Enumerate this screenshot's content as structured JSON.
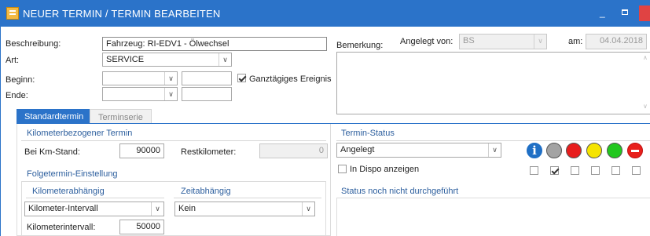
{
  "window": {
    "title": "NEUER TERMIN / TERMIN BEARBEITEN",
    "minimize": "_"
  },
  "form": {
    "beschreibung_label": "Beschreibung:",
    "beschreibung_value": "Fahrzeug: RI-EDV1 - Ölwechsel",
    "art_label": "Art:",
    "art_value": "SERVICE",
    "beginn_label": "Beginn:",
    "ende_label": "Ende:",
    "ganztaegig_label": "Ganztägiges Ereignis",
    "ganztaegig_checked": true,
    "bemerkung_label": "Bemerkung:",
    "angelegt_von_label": "Angelegt von:",
    "angelegt_von_value": "BS",
    "am_label": "am:",
    "am_value": "04.04.2018"
  },
  "tabs": [
    {
      "label": "Standardtermin",
      "active": true
    },
    {
      "label": "Terminserie",
      "active": false
    }
  ],
  "km_section": {
    "title": "Kilometerbezogener Termin",
    "km_stand_label": "Bei Km-Stand:",
    "km_stand_value": "90000",
    "rest_label": "Restkilometer:",
    "rest_value": "0"
  },
  "folge": {
    "title": "Folgetermin-Einstellung",
    "km_abh_label": "Kilometerabhängig",
    "zeit_abh_label": "Zeitabhängig",
    "km_select": "Kilometer-Intervall",
    "zeit_select": "Kein",
    "intervall_label": "Kilometerintervall:",
    "intervall_value": "50000"
  },
  "status": {
    "title": "Termin-Status",
    "select_value": "Angelegt",
    "dispo_label": "In Dispo anzeigen",
    "dispo_checked": false,
    "lights": [
      {
        "name": "info",
        "color": "#1f6fc5",
        "checked": false
      },
      {
        "name": "grey",
        "color": "#a3a3a3",
        "checked": true
      },
      {
        "name": "red",
        "color": "#e81d1d",
        "checked": false
      },
      {
        "name": "yellow",
        "color": "#f5e400",
        "checked": false
      },
      {
        "name": "green",
        "color": "#22c71f",
        "checked": false
      },
      {
        "name": "stop",
        "color": "#e8201c",
        "checked": false
      }
    ],
    "description_title": "Status noch nicht durchgeführt"
  }
}
